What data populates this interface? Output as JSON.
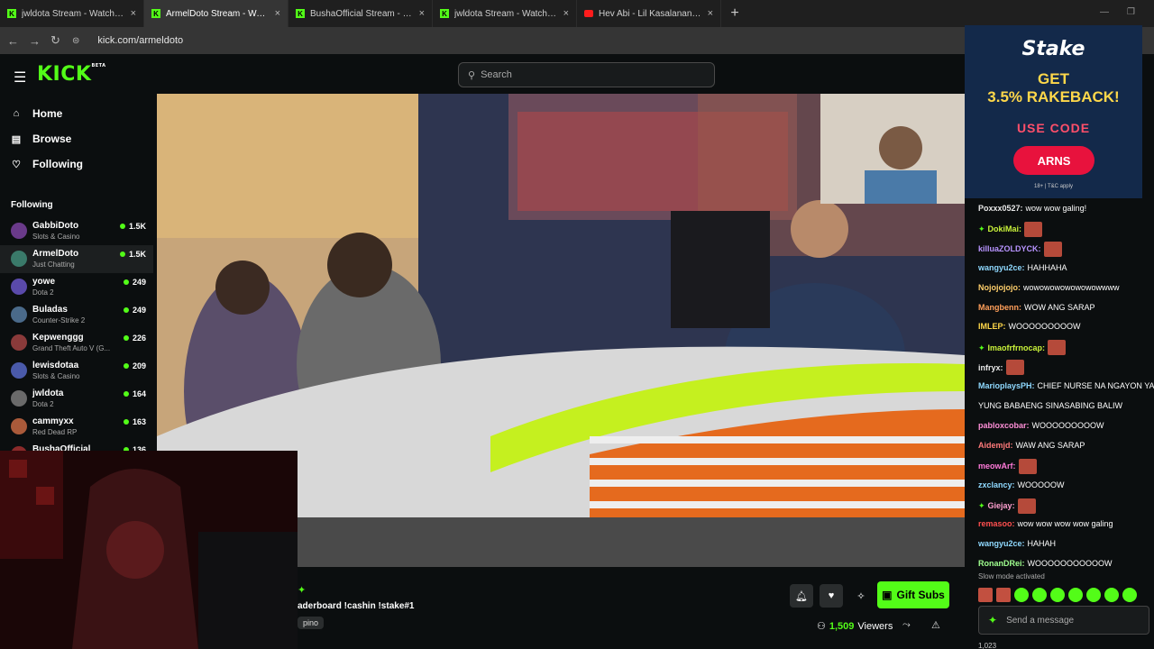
{
  "browser": {
    "tabs": [
      {
        "title": "jwldota Stream - Watch Live on",
        "icon": "kick-icon",
        "active": false
      },
      {
        "title": "ArmelDoto Stream - Watch",
        "icon": "kick-icon",
        "active": true
      },
      {
        "title": "BushaOfficial Stream - Watch L",
        "icon": "kick-icon",
        "active": false
      },
      {
        "title": "jwldota Stream - Watch Live on",
        "icon": "kick-icon",
        "active": false
      },
      {
        "title": "Hev Abi - Lil Kasalanan Shortic",
        "icon": "youtube-icon",
        "active": false
      }
    ],
    "url": "kick.com/armeldoto"
  },
  "header": {
    "logo": "KICK",
    "logo_tag": "BETA",
    "search_placeholder": "Search"
  },
  "nav": {
    "items": [
      {
        "label": "Home",
        "icon": "home-icon"
      },
      {
        "label": "Browse",
        "icon": "browse-icon"
      },
      {
        "label": "Following",
        "icon": "heart-icon"
      }
    ],
    "following_title": "Following"
  },
  "following": [
    {
      "name": "GabbiDoto",
      "category": "Slots & Casino",
      "viewers": "1.5K"
    },
    {
      "name": "ArmelDoto",
      "category": "Just Chatting",
      "viewers": "1.5K"
    },
    {
      "name": "yowe",
      "category": "Dota 2",
      "viewers": "249"
    },
    {
      "name": "Buladas",
      "category": "Counter-Strike 2",
      "viewers": "249"
    },
    {
      "name": "Kepwenggg",
      "category": "Grand Theft Auto V (G...",
      "viewers": "226"
    },
    {
      "name": "lewisdotaa",
      "category": "Slots & Casino",
      "viewers": "209"
    },
    {
      "name": "jwldota",
      "category": "Dota 2",
      "viewers": "164"
    },
    {
      "name": "cammyxx",
      "category": "Red Dead RP",
      "viewers": "163"
    },
    {
      "name": "BushaOfficial",
      "category": "",
      "viewers": "136"
    }
  ],
  "stream": {
    "title": "aderboard !cashin !stake#1",
    "tag": "pino",
    "gift_label": "Gift Subs",
    "viewers_count": "1,509",
    "viewers_label": "Viewers"
  },
  "ad": {
    "brand": "Stake",
    "line1": "GET",
    "line2": "3.5% RAKEBACK!",
    "use_code": "USE CODE",
    "code": "ARNS",
    "terms": "18+ | T&C apply"
  },
  "chat": {
    "messages": [
      {
        "user": "Poxxx0527:",
        "text": "wow wow galing!",
        "color": "#e8e8e8",
        "emote": false,
        "badge": false
      },
      {
        "user": "DokiMai:",
        "text": "",
        "color": "#c9f23a",
        "emote": true,
        "badge": true
      },
      {
        "user": "killuaZOLDYCK:",
        "text": "",
        "color": "#b894ff",
        "emote": true,
        "badge": false
      },
      {
        "user": "wangyu2ce:",
        "text": "HAHHAHA",
        "color": "#8fd9ff",
        "emote": false,
        "badge": false
      },
      {
        "user": "Nojojojojo:",
        "text": "wowowowowowowowwww",
        "color": "#ffcf6b",
        "emote": false,
        "badge": false
      },
      {
        "user": "Mangbenn:",
        "text": "WOW ANG SARAP",
        "color": "#ff9f5a",
        "emote": false,
        "badge": false
      },
      {
        "user": "IMLEP:",
        "text": "WOOOOOOOOOW",
        "color": "#ffd84a",
        "emote": false,
        "badge": false
      },
      {
        "user": "Imaofrfrnocap:",
        "text": "",
        "color": "#c9f23a",
        "emote": true,
        "badge": true
      },
      {
        "user": "infryx:",
        "text": "",
        "color": "#e8e8e8",
        "emote": true,
        "badge": false
      },
      {
        "user": "MarioplaysPH:",
        "text": "CHIEF NURSE NA NGAYON YAN",
        "color": "#8fd9ff",
        "emote": false,
        "badge": false
      },
      {
        "user": "",
        "text": "YUNG BABAENG SINASABING BALIW",
        "color": "#e8e8e8",
        "emote": false,
        "badge": false
      },
      {
        "user": "pabloxcobar:",
        "text": "WOOOOOOOOOW",
        "color": "#ff8fd8",
        "emote": false,
        "badge": false
      },
      {
        "user": "Aidemjd:",
        "text": "WAW ANG SARAP",
        "color": "#ff7a7a",
        "emote": false,
        "badge": false
      },
      {
        "user": "meowArf:",
        "text": "",
        "color": "#ff7ad9",
        "emote": true,
        "badge": false
      },
      {
        "user": "zxclancy:",
        "text": "WOOOOOW",
        "color": "#8fd9ff",
        "emote": false,
        "badge": false
      },
      {
        "user": "Giejay:",
        "text": "",
        "color": "#ff9fd0",
        "emote": true,
        "badge": true
      },
      {
        "user": "remasoo:",
        "text": "wow wow wow wow galing",
        "color": "#ff4f4f",
        "emote": false,
        "badge": false
      },
      {
        "user": "wangyu2ce:",
        "text": "HAHAH",
        "color": "#8fd9ff",
        "emote": false,
        "badge": false
      },
      {
        "user": "RonanDRei:",
        "text": "WOOOOOOOOOOOW",
        "color": "#a0ff8f",
        "emote": false,
        "badge": false
      }
    ],
    "slow_mode": "Slow mode activated",
    "input_placeholder": "Send a message",
    "footer_count": "1,023"
  },
  "colors": {
    "accent": "#53fc18",
    "bg": "#0b0e0f"
  }
}
